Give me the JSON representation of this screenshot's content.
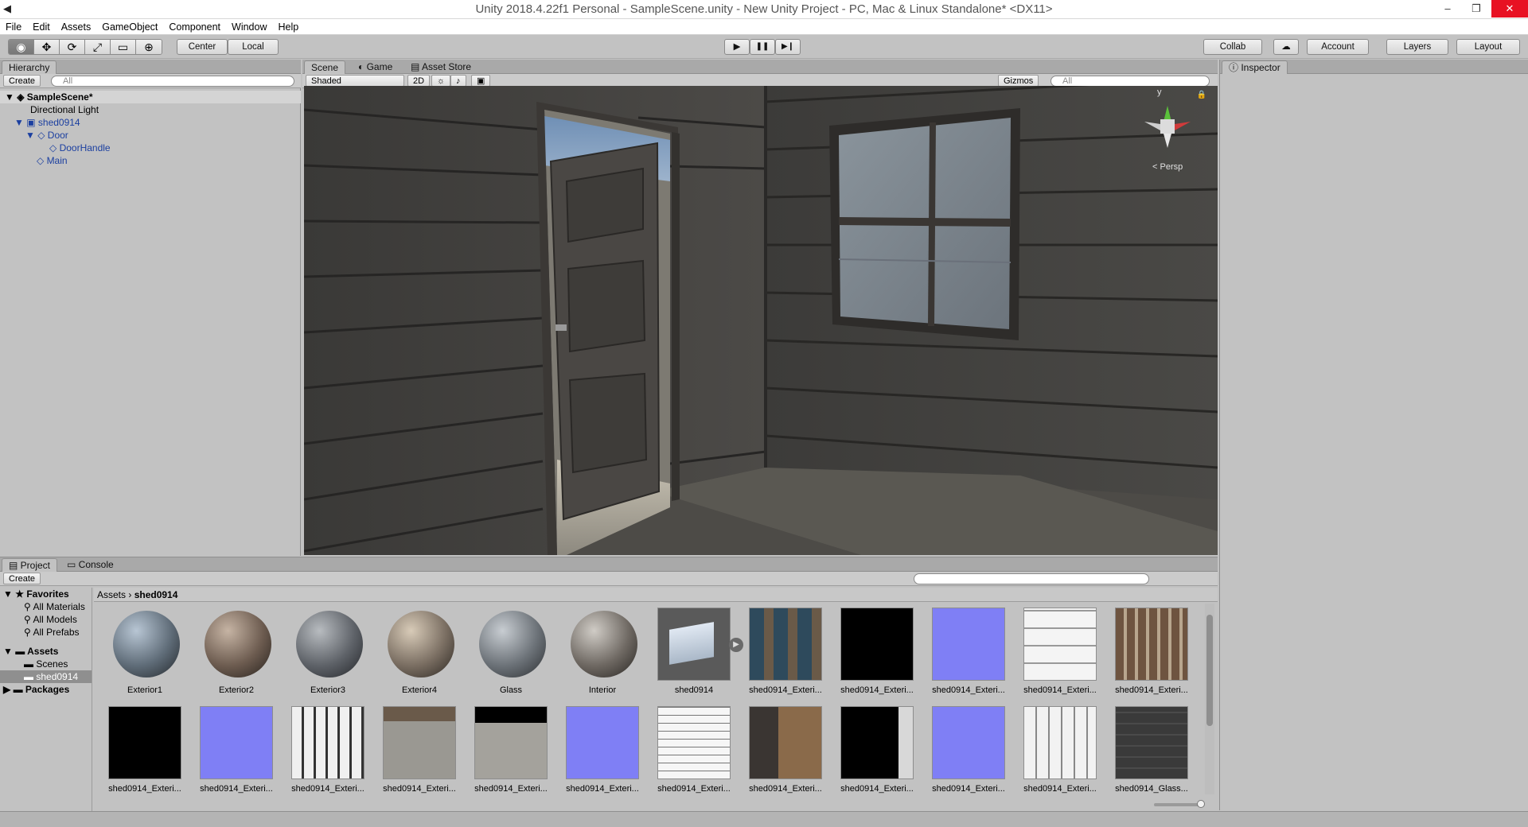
{
  "window": {
    "title": "Unity 2018.4.22f1 Personal - SampleScene.unity - New Unity Project - PC, Mac & Linux Standalone* <DX11>",
    "minimize": "–",
    "restore": "❐",
    "close": "✕"
  },
  "menu": [
    "File",
    "Edit",
    "Assets",
    "GameObject",
    "Component",
    "Window",
    "Help"
  ],
  "toolbar": {
    "tools": [
      "◉",
      "✥",
      "⟳",
      "⤢",
      "▭",
      "⊕"
    ],
    "pivot": "Center",
    "space": "Local",
    "play": "▶",
    "pause": "❚❚",
    "step": "▶❙",
    "collab": "Collab",
    "cloud": "☁",
    "account": "Account",
    "layers": "Layers",
    "layout": "Layout"
  },
  "hierarchy": {
    "tab": "Hierarchy",
    "create": "Create",
    "search_placeholder": "All",
    "scene": "SampleScene*",
    "items": [
      "Directional Light",
      "shed0914",
      "Door",
      "DoorHandle",
      "Main"
    ]
  },
  "scene": {
    "tabs": [
      "Scene",
      "Game",
      "Asset Store"
    ],
    "shading": "Shaded",
    "mode2d": "2D",
    "gizmos": "Gizmos",
    "search_placeholder": "All",
    "persp": "Persp",
    "axis_y": "y"
  },
  "inspector": {
    "tab": "Inspector"
  },
  "project": {
    "tabs": [
      "Project",
      "Console"
    ],
    "create": "Create",
    "favorites_label": "Favorites",
    "favorites": [
      "All Materials",
      "All Models",
      "All Prefabs"
    ],
    "assets_label": "Assets",
    "assets_children": [
      "Scenes",
      "shed0914"
    ],
    "packages_label": "Packages",
    "breadcrumb": [
      "Assets",
      "shed0914"
    ],
    "row1": [
      "Exterior1",
      "Exterior2",
      "Exterior3",
      "Exterior4",
      "Glass",
      "Interior",
      "shed0914",
      "shed0914_Exteri...",
      "shed0914_Exteri...",
      "shed0914_Exteri...",
      "shed0914_Exteri...",
      "shed0914_Exteri..."
    ],
    "row2": [
      "shed0914_Exteri...",
      "shed0914_Exteri...",
      "shed0914_Exteri...",
      "shed0914_Exteri...",
      "shed0914_Exteri...",
      "shed0914_Exteri...",
      "shed0914_Exteri...",
      "shed0914_Exteri...",
      "shed0914_Exteri...",
      "shed0914_Exteri...",
      "shed0914_Exteri...",
      "shed0914_Glass..."
    ]
  }
}
